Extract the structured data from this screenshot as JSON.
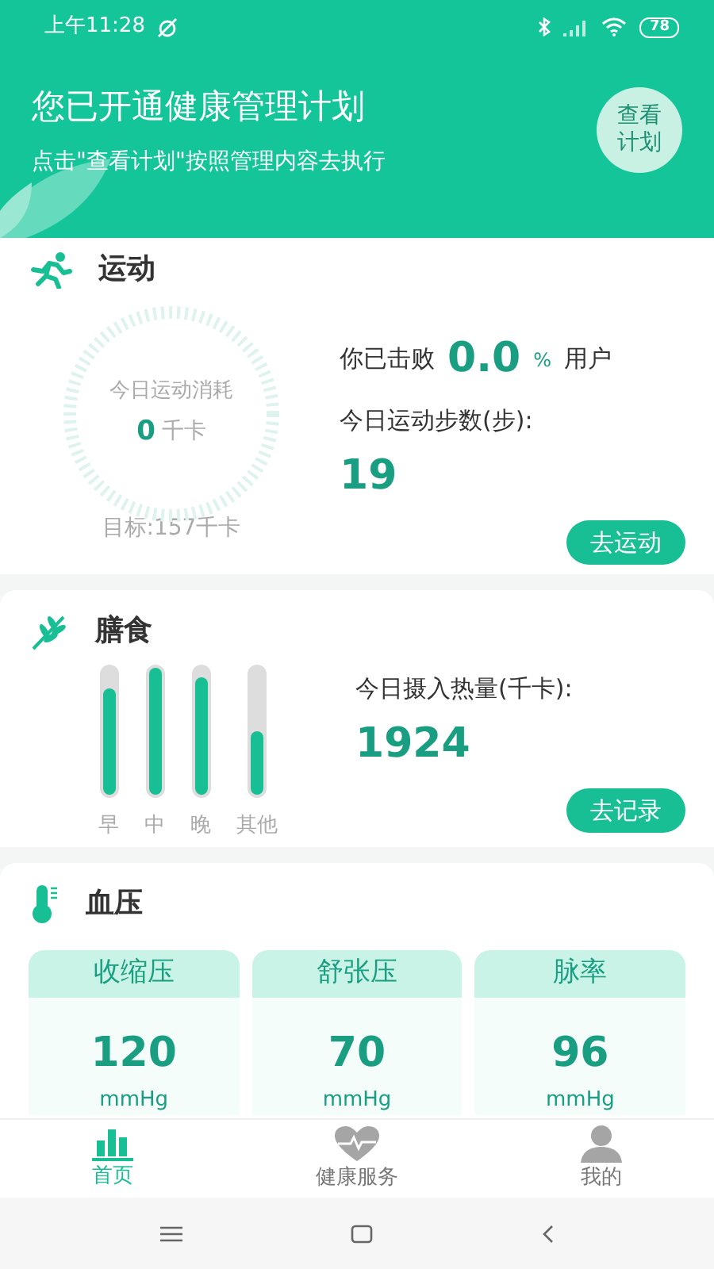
{
  "status_bar": {
    "time": "上午11:28",
    "battery": "78"
  },
  "header": {
    "title": "您已开通健康管理计划",
    "subtitle": "点击\"查看计划\"按照管理内容去执行",
    "plan_button": "查看计划"
  },
  "exercise": {
    "title": "运动",
    "dial_label": "今日运动消耗",
    "calories": "0",
    "calories_unit": "千卡",
    "goal": "目标:157千卡",
    "beat_prefix": "你已击败",
    "beat_value": "0.0",
    "beat_percent": "%",
    "beat_suffix": "用户",
    "steps_label": "今日运动步数(步):",
    "steps": "19",
    "button": "去运动"
  },
  "diet": {
    "title": "膳食",
    "meals": [
      {
        "label": "早",
        "level": 0.84
      },
      {
        "label": "中",
        "level": 1.0
      },
      {
        "label": "晚",
        "level": 0.93
      },
      {
        "label": "其他",
        "level": 0.5
      }
    ],
    "intake_label": "今日摄入热量(千卡):",
    "intake": "1924",
    "button": "去记录"
  },
  "blood_pressure": {
    "title": "血压",
    "tiles": [
      {
        "label": "收缩压",
        "value": "120",
        "unit": "mmHg"
      },
      {
        "label": "舒张压",
        "value": "70",
        "unit": "mmHg"
      },
      {
        "label": "脉率",
        "value": "96",
        "unit": "mmHg"
      }
    ]
  },
  "tab_bar": [
    {
      "label": "首页",
      "kind": "chart",
      "selected": true
    },
    {
      "label": "健康服务",
      "kind": "heart",
      "selected": false
    },
    {
      "label": "我的",
      "kind": "person",
      "selected": false
    }
  ]
}
